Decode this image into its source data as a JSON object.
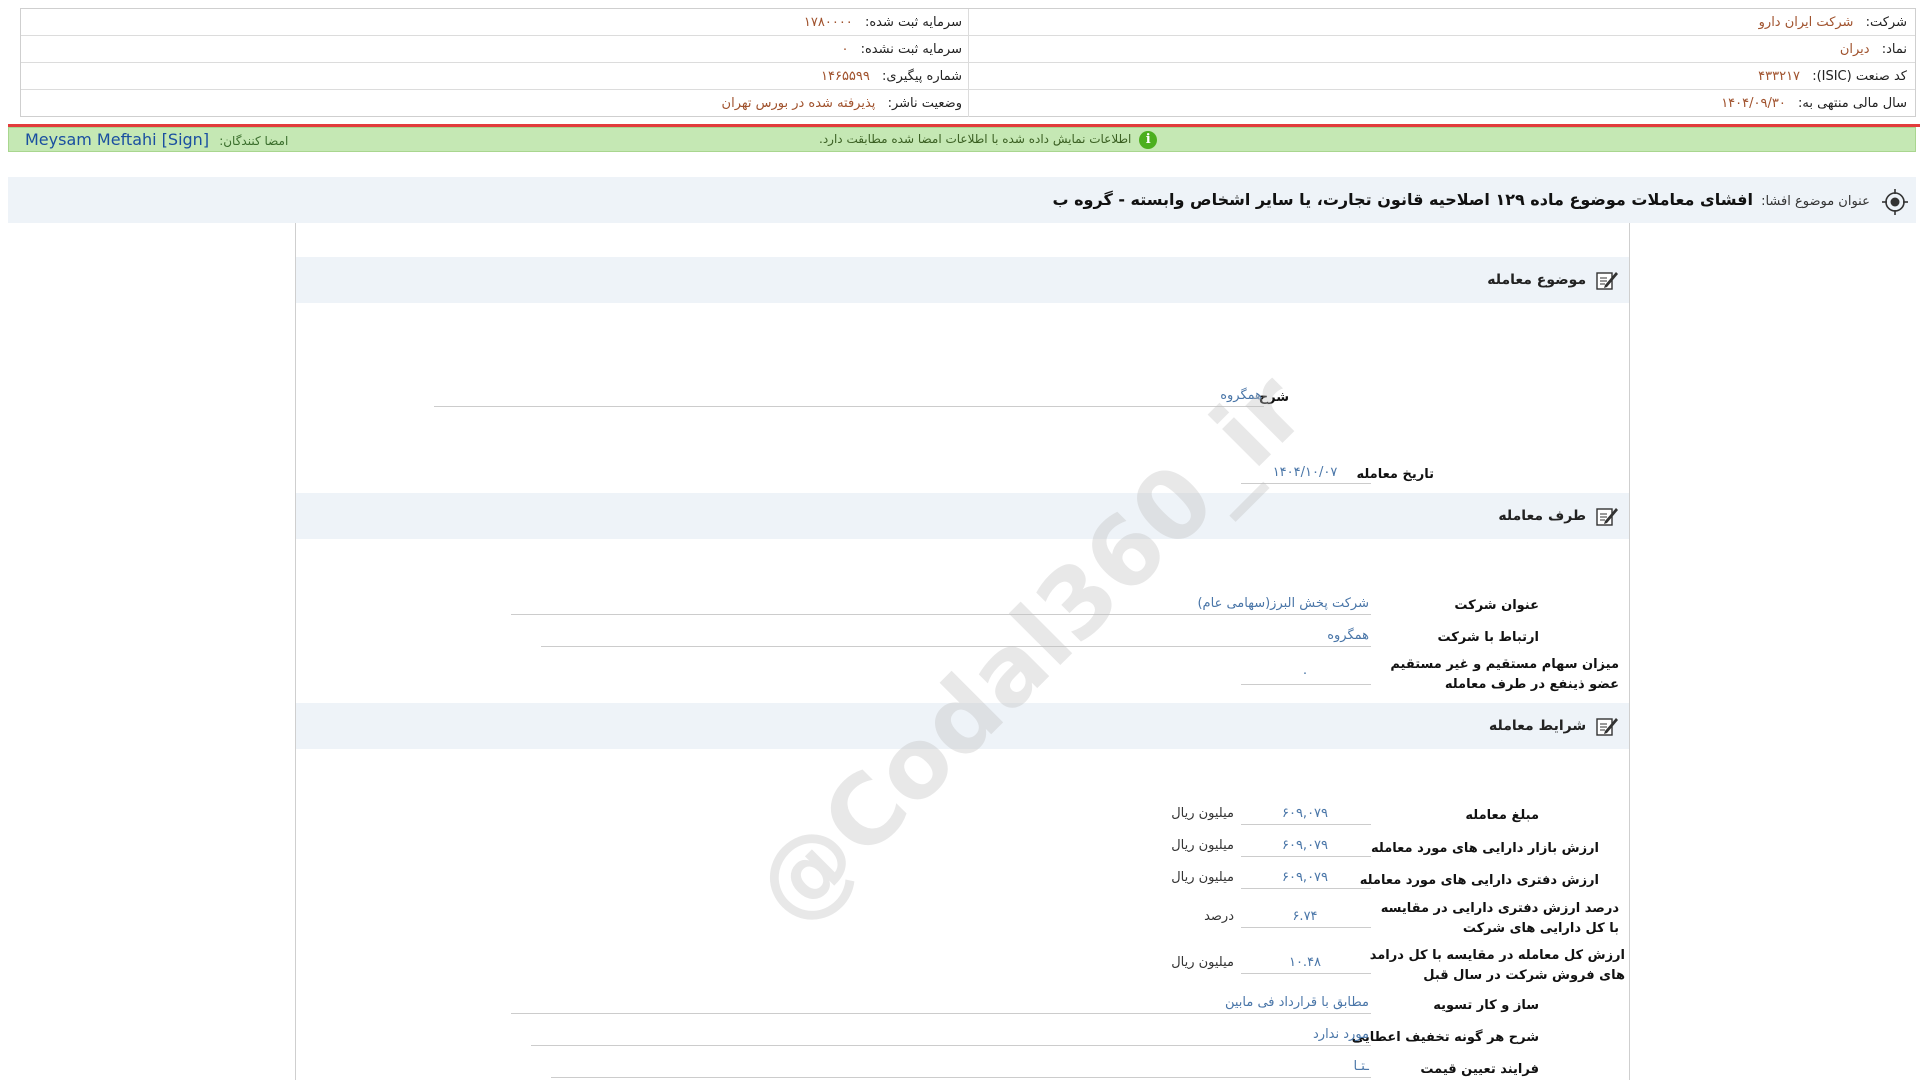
{
  "company_info": {
    "company_label": "شرکت:",
    "company_value": "شرکت ایران دارو",
    "registered_capital_label": "سرمایه ثبت شده:",
    "registered_capital_value": "۱۷۸۰۰۰۰",
    "symbol_label": "نماد:",
    "symbol_value": "دیران",
    "unregistered_capital_label": "سرمایه ثبت نشده:",
    "unregistered_capital_value": "۰",
    "isic_label": "کد صنعت (ISIC):",
    "isic_value": "۴۳۳۲۱۷",
    "tracking_label": "شماره پیگیری:",
    "tracking_value": "۱۴۶۵۵۹۹",
    "fiscal_year_label": "سال مالی منتهی به:",
    "fiscal_year_value": "۱۴۰۴/۰۹/۳۰",
    "publisher_status_label": "وضعیت ناشر:",
    "publisher_status_value": "پذیرفته شده در بورس تهران"
  },
  "notice_bar": {
    "signers_label": "امضا کنندگان:",
    "signer_name": "Meysam Meftahi [Sign]",
    "message": "اطلاعات نمایش داده شده با اطلاعات امضا شده مطابقت دارد.",
    "icon": "info-icon",
    "color": "#c5e8b4"
  },
  "topic": {
    "label": "عنوان موضوع افشا:",
    "title": "افشای معاملات موضوع ماده ۱۲۹ اصلاحیه قانون تجارت، یا سایر اشخاص وابسته - گروه ب",
    "icon": "target-icon"
  },
  "sections": {
    "subject": {
      "title": "موضوع معامله",
      "description_label": "شرح",
      "description_value": "همگروه",
      "date_label": "تاریخ معامله",
      "date_value": "۱۴۰۴/۱۰/۰۷"
    },
    "party": {
      "title": "طرف معامله",
      "company_title_label": "عنوان شرکت",
      "company_title_value": "شرکت پخش البرز(سهامی عام)",
      "relation_label": "ارتباط با شرکت",
      "relation_value": "همگروه",
      "shares_label": "میزان سهام مستقیم و غیر مستقیم عضو ذینفع در طرف معامله",
      "shares_value": "۰"
    },
    "terms": {
      "title": "شرایط معامله",
      "amount_label": "مبلغ معامله",
      "amount_value": "۶۰۹,۰۷۹",
      "amount_unit": "میلیون ریال",
      "market_value_label": "ارزش بازار دارایی های مورد معامله",
      "market_value_value": "۶۰۹,۰۷۹",
      "market_value_unit": "میلیون ریال",
      "book_value_label": "ارزش دفتری دارایی های مورد معامله",
      "book_value_value": "۶۰۹,۰۷۹",
      "book_value_unit": "میلیون ریال",
      "book_percent_label": "درصد ارزش دفتری دارایی در مقایسه با کل دارایی های شرکت",
      "book_percent_value": "۶.۷۴",
      "book_percent_unit": "درصد",
      "sales_ratio_label": "ارزش کل معامله در مقایسه با کل درامد های فروش شرکت در سال قبل",
      "sales_ratio_value": "۱۰.۴۸",
      "sales_ratio_unit": "میلیون ریال",
      "settlement_label": "ساز و کار تسویه",
      "settlement_value": "مطابق با قرارداد فی مابین",
      "discount_label": "شرح هر گونه تخفیف اعطایی",
      "discount_value": "مورد ندارد",
      "pricing_label": "فرایند تعیین قیمت",
      "pricing_value": "ـتـا"
    }
  },
  "watermark": "@Codal360_ir"
}
